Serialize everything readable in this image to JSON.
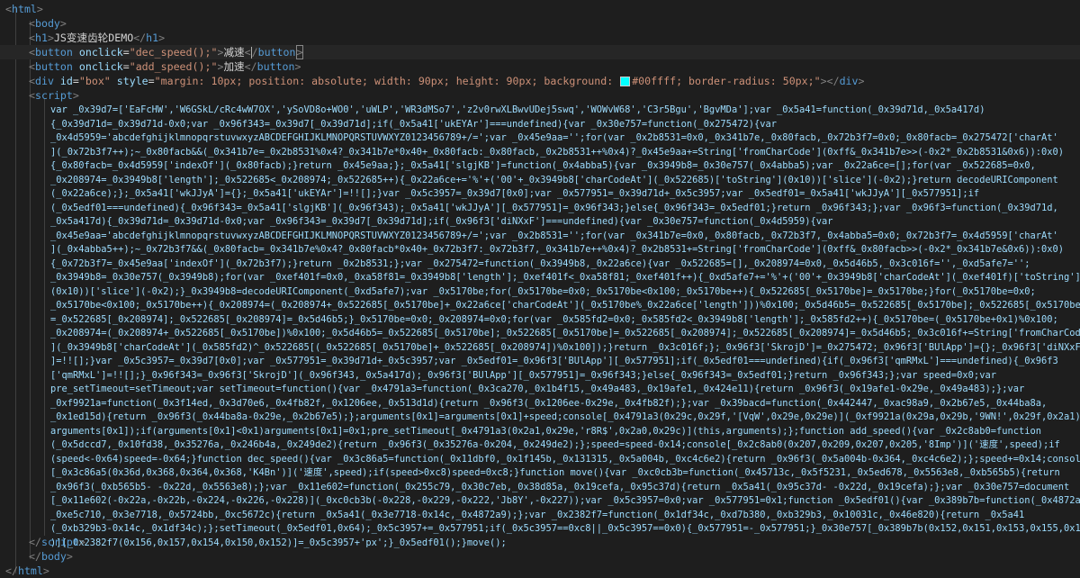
{
  "html_open": "html",
  "body_open": "body",
  "h1": {
    "tag": "h1",
    "text": "JS变速齿轮DEMO"
  },
  "button1": {
    "attr": "onclick",
    "value": "\"dec_speed();\"",
    "text": "减速"
  },
  "button2": {
    "attr": "onclick",
    "value": "\"add_speed();\"",
    "text": "加速"
  },
  "div_box": {
    "id_attr": "id",
    "id_value": "\"box\"",
    "style_attr": "style",
    "style_value_1": "\"margin: 10px; position: absolute; width: 90px; height: 90px; background: ",
    "color": "#00ffff",
    "style_value_2": "; border-radius: 50px;\""
  },
  "script_tag": "script",
  "code_lines": [
    "var _0x39d7=['EaFcHW','W6GSkL/cRc4wW7OX','ySoVD8o+WO0','uWLP','WR3dMSo7','z2v0rwXLBwvUDej5swq','WOWvW68','C3r5Bgu','BgvMDa'];var _0x5a41=function(_0x39d71d,_0x5a417d)",
    "{_0x39d71d=_0x39d71d-0x0;var _0x96f343=_0x39d7[_0x39d71d];if(_0x5a41['ukEYAr']===undefined){var _0x30e757=function(_0x275472){var",
    "_0x4d5959='abcdefghijklmnopqrstuvwxyzABCDEFGHIJKLMNOPQRSTUVWXYZ0123456789+/=';var _0x45e9aa='';for(var _0x2b8531=0x0,_0x341b7e,_0x80facb,_0x72b3f7=0x0;_0x80facb=_0x275472['charAt'",
    "](_0x72b3f7++);~_0x80facb&&(_0x341b7e=_0x2b8531%0x4?_0x341b7e*0x40+_0x80facb:_0x80facb,_0x2b8531++%0x4)?_0x45e9aa+=String['fromCharCode'](0xff&_0x341b7e>>(-0x2*_0x2b8531&0x6)):0x0)",
    "{_0x80facb=_0x4d5959['indexOf'](_0x80facb);}return _0x45e9aa;};_0x5a41['slgjKB']=function(_0x4abba5){var _0x3949b8=_0x30e757(_0x4abba5);var _0x22a6ce=[];for(var _0x522685=0x0,",
    "_0x208974=_0x3949b8['length'];_0x522685<_0x208974;_0x522685++){_0x22a6ce+='%'+('00'+_0x3949b8['charCodeAt'](_0x522685)['toString'](0x10))['slice'](-0x2);}return decodeURIComponent",
    "(_0x22a6ce);};_0x5a41['wkJJyA']={};_0x5a41['ukEYAr']=!![];}var _0x5c3957=_0x39d7[0x0];var _0x577951=_0x39d71d+_0x5c3957;var _0x5edf01=_0x5a41['wkJJyA'][_0x577951];if",
    "(_0x5edf01===undefined){_0x96f343=_0x5a41['slgjKB'](_0x96f343);_0x5a41['wkJJyA'][_0x577951]=_0x96f343;}else{_0x96f343=_0x5edf01;}return _0x96f343;};var _0x96f3=function(_0x39d71d,",
    "_0x5a417d){_0x39d71d=_0x39d71d-0x0;var _0x96f343=_0x39d7[_0x39d71d];if(_0x96f3['diNXxF']===undefined){var _0x30e757=function(_0x4d5959){var",
    "_0x45e9aa='abcdefghijklmnopqrstuvwxyzABCDEFGHIJKLMNOPQRSTUVWXYZ0123456789+/=';var _0x2b8531='';for(var _0x341b7e=0x0,_0x80facb,_0x72b3f7,_0x4abba5=0x0;_0x72b3f7=_0x4d5959['charAt'",
    "](_0x4abba5++);~_0x72b3f7&&(_0x80facb=_0x341b7e%0x4?_0x80facb*0x40+_0x72b3f7:_0x72b3f7,_0x341b7e++%0x4)?_0x2b8531+=String['fromCharCode'](0xff&_0x80facb>>(-0x2*_0x341b7e&0x6)):0x0)",
    "{_0x72b3f7=_0x45e9aa['indexOf'](_0x72b3f7);}return _0x2b8531;};var _0x275472=function(_0x3949b8,_0x22a6ce){var _0x522685=[],_0x208974=0x0,_0x5d46b5,_0x3c016f='',_0xd5afe7='';",
    "_0x3949b8=_0x30e757(_0x3949b8);for(var _0xef401f=0x0,_0xa58f81=_0x3949b8['length'];_0xef401f<_0xa58f81;_0xef401f++){_0xd5afe7+='%'+('00'+_0x3949b8['charCodeAt'](_0xef401f)['toString']",
    "(0x10))['slice'](-0x2);}_0x3949b8=decodeURIComponent(_0xd5afe7);var _0x5170be;for(_0x5170be=0x0;_0x5170be<0x100;_0x5170be++){_0x522685[_0x5170be]=_0x5170be;}for(_0x5170be=0x0;",
    "_0x5170be<0x100;_0x5170be++){_0x208974=(_0x208974+_0x522685[_0x5170be]+_0x22a6ce['charCodeAt'](_0x5170be%_0x22a6ce['length']))%0x100;_0x5d46b5=_0x522685[_0x5170be];_0x522685[_0x5170be]",
    "=_0x522685[_0x208974];_0x522685[_0x208974]=_0x5d46b5;}_0x5170be=0x0;_0x208974=0x0;for(var _0x585fd2=0x0;_0x585fd2<_0x3949b8['length'];_0x585fd2++){_0x5170be=(_0x5170be+0x1)%0x100;",
    "_0x208974=(_0x208974+_0x522685[_0x5170be])%0x100;_0x5d46b5=_0x522685[_0x5170be];_0x522685[_0x5170be]=_0x522685[_0x208974];_0x522685[_0x208974]=_0x5d46b5;_0x3c016f+=String['fromCharCode'",
    "](_0x3949b8['charCodeAt'](_0x585fd2)^_0x522685[(_0x522685[_0x5170be]+_0x522685[_0x208974])%0x100]);}return _0x3c016f;};_0x96f3['SkrojD']=_0x275472;_0x96f3['BUlApp']={};_0x96f3['diNXxF'",
    "]=!![];}var _0x5c3957=_0x39d7[0x0];var _0x577951=_0x39d71d+_0x5c3957;var _0x5edf01=_0x96f3['BUlApp'][_0x577951];if(_0x5edf01===undefined){if(_0x96f3['qmRMxL']===undefined){_0x96f3",
    "['qmRMxL']=!![];}_0x96f343=_0x96f3['SkrojD'](_0x96f343,_0x5a417d);_0x96f3['BUlApp'][_0x577951]=_0x96f343;}else{_0x96f343=_0x5edf01;}return _0x96f343;};var speed=0x0;var",
    "pre_setTimeout=setTimeout;var setTimeout=function(){var _0x4791a3=function(_0x3ca270,_0x1b4f15,_0x49a483,_0x19afe1,_0x424e11){return _0x96f3(_0x19afe1-0x29e,_0x49a483);};var",
    "_0xf9921a=function(_0x3f14ed,_0x3d70e6,_0x4fb82f,_0x1206ee,_0x513d1d){return _0x96f3(_0x1206ee-0x29e,_0x4fb82f);};var _0x39bacd=function(_0x442447,_0xac98a9,_0x2b67e5,_0x44ba8a,",
    "_0x1ed15d){return _0x96f3(_0x44ba8a-0x29e,_0x2b67e5);};arguments[0x1]=arguments[0x1]+speed;console[_0x4791a3(0x29c,0x29f,'[VqW',0x29e,0x29e)](_0xf9921a(0x29a,0x29b,'9WN!',0x29f,0x2a1),",
    "arguments[0x1]);if(arguments[0x1]<0x1)arguments[0x1]=0x1;pre_setTimeout[_0x4791a3(0x2a1,0x29e,'r8R$',0x2a0,0x29c)](this,arguments);};function add_speed(){var _0x2c8ab0=function",
    "(_0x5dccd7,_0x10fd38,_0x35276a,_0x246b4a,_0x249de2){return _0x96f3(_0x35276a-0x204,_0x249de2);};speed=speed-0x14;console[_0x2c8ab0(0x207,0x209,0x207,0x205,'8Imp')]('速度',speed);if",
    "(speed<-0x64)speed=-0x64;}function dec_speed(){var _0x3c86a5=function(_0x11dbf0,_0x1f145b,_0x131315,_0x5a004b,_0xc4c6e2){return _0x96f3(_0x5a004b-0x364,_0xc4c6e2);};speed+=0x14;console",
    "[_0x3c86a5(0x36d,0x368,0x364,0x368,'K4Bn')]('速度',speed);if(speed>0xc8)speed=0xc8;}function move(){var _0xc0cb3b=function(_0x45713c,_0x5f5231,_0x5ed678,_0x5563e8,_0xb565b5){return",
    "_0x96f3(_0xb565b5- -0x22d,_0x5563e8);};var _0x11e602=function(_0x255c79,_0x30c7eb,_0x38d85a,_0x19cefa,_0x95c37d){return _0x5a41(_0x95c37d- -0x22d,_0x19cefa);};var _0x30e757=document",
    "[_0x11e602(-0x22a,-0x22b,-0x224,-0x226,-0x228)](_0xc0cb3b(-0x228,-0x229,-0x222,'Jb8Y',-0x227));var _0x5c3957=0x0;var _0x577951=0x1;function _0x5edf01(){var _0x389b7b=function(_0x4872a9,",
    "_0xe5c710,_0x3e7718,_0x5724bb,_0xc5672c){return _0x5a41(_0x3e7718-0x14c,_0x4872a9);};var _0x2382f7=function(_0x1df34c,_0xd7b380,_0xb329b3,_0x10031c,_0x46e820){return _0x5a41",
    "(_0xb329b3-0x14c,_0x1df34c);};setTimeout(_0x5edf01,0x64);_0x5c3957+=_0x577951;if(_0x5c3957==0xc8||_0x5c3957==0x0){_0x577951=-_0x577951;}_0x30e757[_0x389b7b(0x152,0x151,0x153,0x155,0x151",
    ")][_0x2382f7(0x156,0x157,0x154,0x150,0x152)]=_0x5c3957+'px';}_0x5edf01();}move();"
  ],
  "script_close": "script",
  "body_close": "body",
  "html_close": "html"
}
